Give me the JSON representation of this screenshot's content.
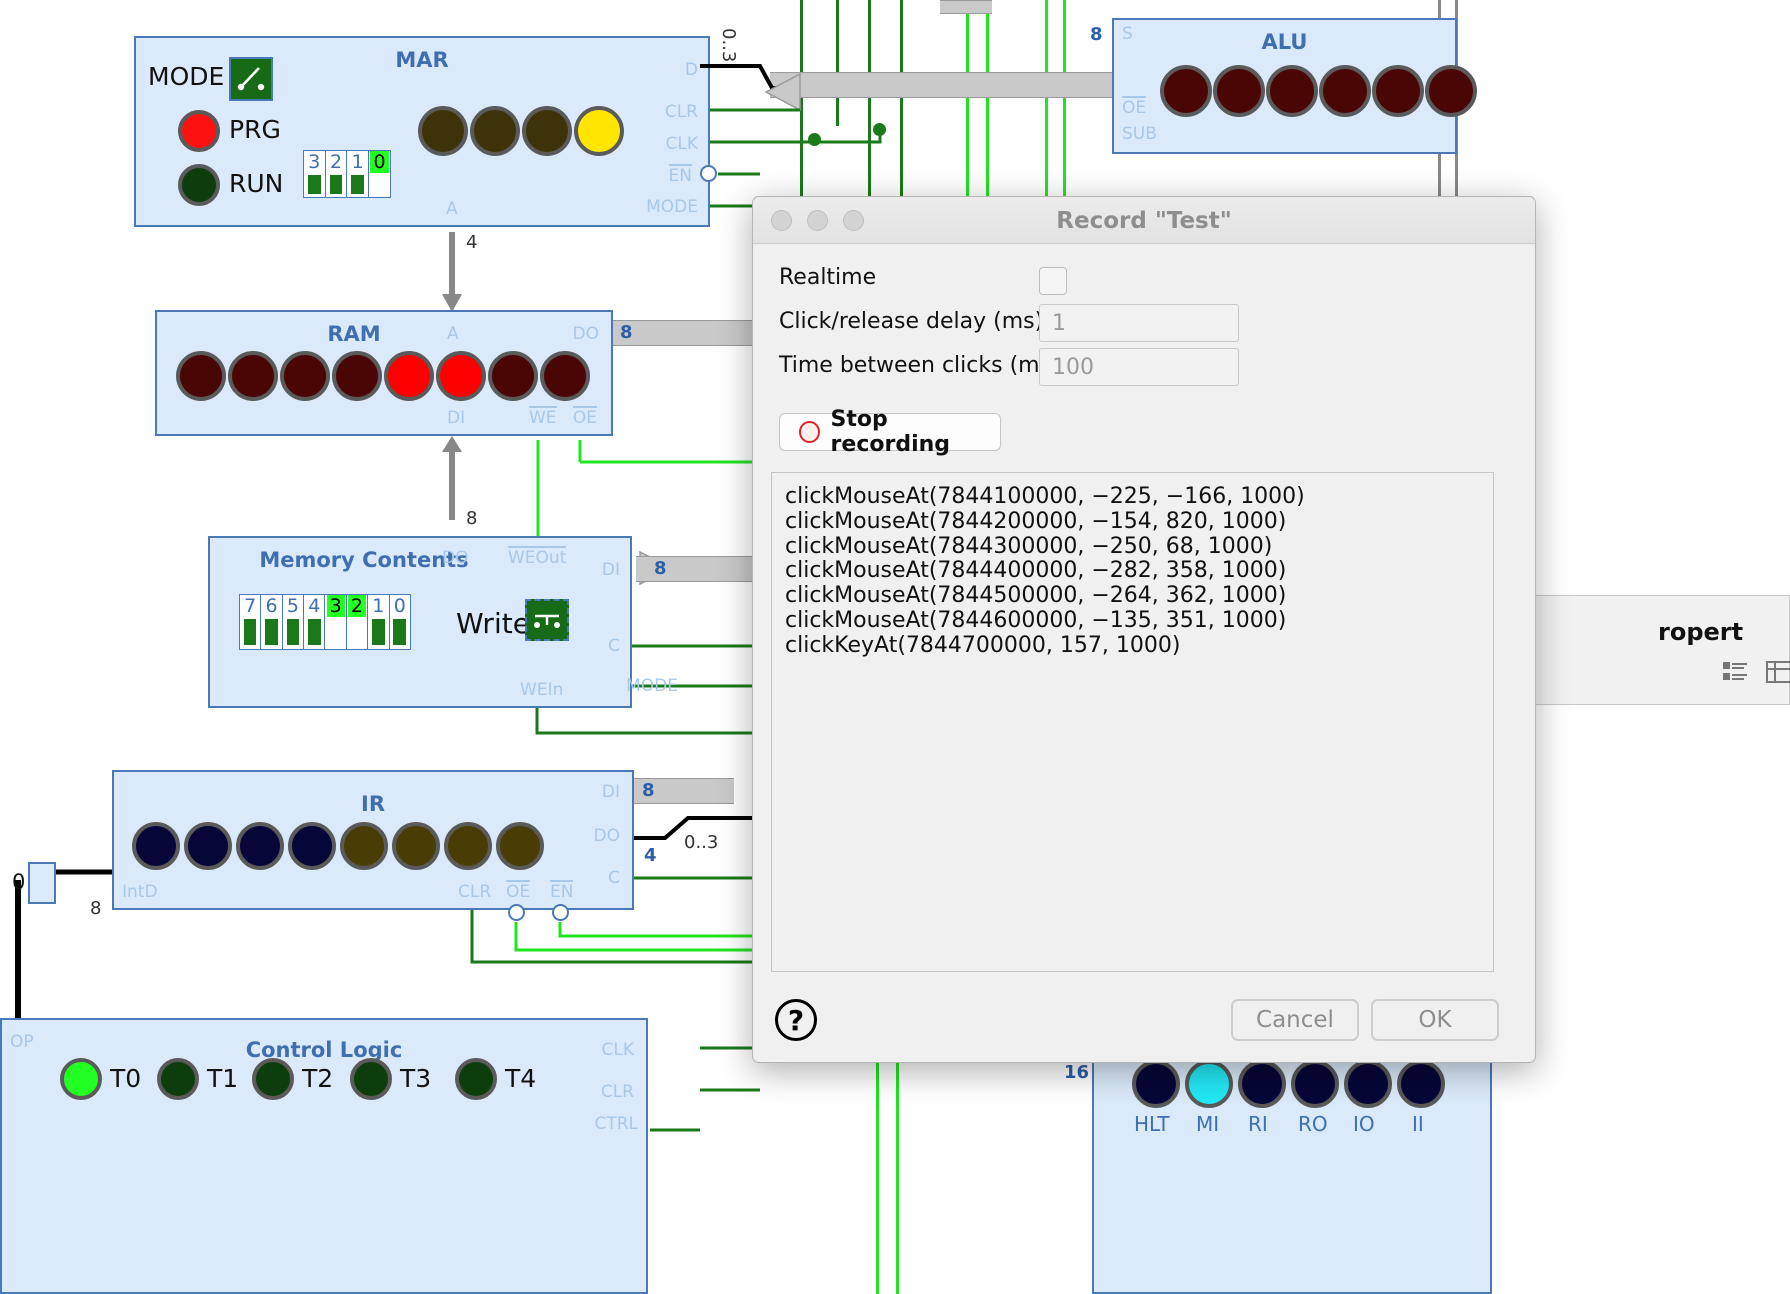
{
  "dialog": {
    "title": "Record \"Test\"",
    "traffic_lights": [
      "close-button",
      "minimize-button",
      "zoom-button"
    ],
    "realtime_label": "Realtime",
    "realtime_checked": false,
    "click_release_label": "Click/release delay (ms):",
    "click_release_value": "1",
    "time_between_label": "Time between clicks (ms):",
    "time_between_value": "100",
    "stop_button_label": "Stop recording",
    "help_label": "?",
    "cancel_label": "Cancel",
    "ok_label": "OK",
    "log_lines": [
      "clickMouseAt(7844100000, −225, −166, 1000)",
      "clickMouseAt(7844200000, −154, 820, 1000)",
      "clickMouseAt(7844300000, −250, 68, 1000)",
      "clickMouseAt(7844400000, −282, 358, 1000)",
      "clickMouseAt(7844500000, −264, 362, 1000)",
      "clickMouseAt(7844600000, −135, 351, 1000)",
      "clickKeyAt(7844700000, 157, 1000)"
    ]
  },
  "circuit": {
    "mar": {
      "title": "MAR",
      "mode_label": "MODE",
      "prg_label": "PRG",
      "run_label": "RUN",
      "prg_color": "#ff1111",
      "run_color": "#0d3d0d",
      "switch_labels": [
        "3",
        "2",
        "1",
        "0"
      ],
      "switch_on": [
        true,
        true,
        true,
        false
      ],
      "switch_highlight": [
        false,
        false,
        false,
        true
      ],
      "leds": [
        "#3d3208",
        "#3d3208",
        "#3d3208",
        "#ffe500"
      ],
      "pins_right": [
        "D",
        "CLR",
        "CLK",
        "EN",
        "MODE"
      ],
      "pin_bottom": "A",
      "bus_width_bottom": "4",
      "bus_width_d": "0..3"
    },
    "ram": {
      "title": "RAM",
      "pin_a": "A",
      "pin_do": "DO",
      "pin_di": "DI",
      "pin_we": "WE",
      "pin_oe": "OE",
      "bus_do": "8",
      "bus_di": "8",
      "leds": [
        "#4a0505",
        "#4a0505",
        "#4a0505",
        "#4a0505",
        "#ff0000",
        "#ff0000",
        "#4a0505",
        "#4a0505"
      ]
    },
    "memory": {
      "title": "Memory Contents",
      "pin_do": "DO",
      "pin_weout": "WEOut",
      "pin_di": "DI",
      "pin_c": "C",
      "pin_mode": "MODE",
      "pin_wein": "WEIn",
      "bus_di": "8",
      "write_label": "Write",
      "switch_labels": [
        "7",
        "6",
        "5",
        "4",
        "3",
        "2",
        "1",
        "0"
      ],
      "switch_on": [
        true,
        true,
        true,
        true,
        false,
        false,
        true,
        true
      ],
      "switch_highlight": [
        false,
        false,
        false,
        false,
        true,
        true,
        false,
        false
      ]
    },
    "ir": {
      "title": "IR",
      "pin_di": "DI",
      "pin_do": "DO",
      "pin_c": "C",
      "pin_intd": "IntD",
      "pin_clr": "CLR",
      "pin_oe": "OE",
      "pin_en": "EN",
      "bus_di": "8",
      "bus_do": "4",
      "bus_do_range": "0..3",
      "leds": [
        "#060638",
        "#060638",
        "#060638",
        "#060638",
        "#4a3c05",
        "#4a3c05",
        "#4a3c05",
        "#4a3c05"
      ]
    },
    "control": {
      "title": "Control Logic",
      "pin_op": "OP",
      "pin_clk": "CLK",
      "pin_clr": "CLR",
      "pin_ctrl": "CTRL",
      "t_labels": [
        "T0",
        "T1",
        "T2",
        "T3",
        "T4"
      ],
      "t_colors": [
        "#22ff22",
        "#0d3d0d",
        "#0d3d0d",
        "#0d3d0d",
        "#0d3d0d"
      ]
    },
    "alu": {
      "title": "ALU",
      "pin_s": "S",
      "pin_oe": "OE",
      "pin_sub": "SUB",
      "bus_s": "8",
      "leds": [
        "#4a0505",
        "#4a0505",
        "#4a0505",
        "#4a0505",
        "#4a0505",
        "#4a0505"
      ]
    },
    "ctrlbus": {
      "count": "16",
      "labels": [
        "HLT",
        "MI",
        "RI",
        "RO",
        "IO",
        "II"
      ],
      "led_colors": [
        "#060638",
        "#22e8f5",
        "#060638",
        "#060638",
        "#060638",
        "#060638"
      ]
    },
    "left_edge": {
      "value_0": "0",
      "bus_8": "8"
    }
  }
}
